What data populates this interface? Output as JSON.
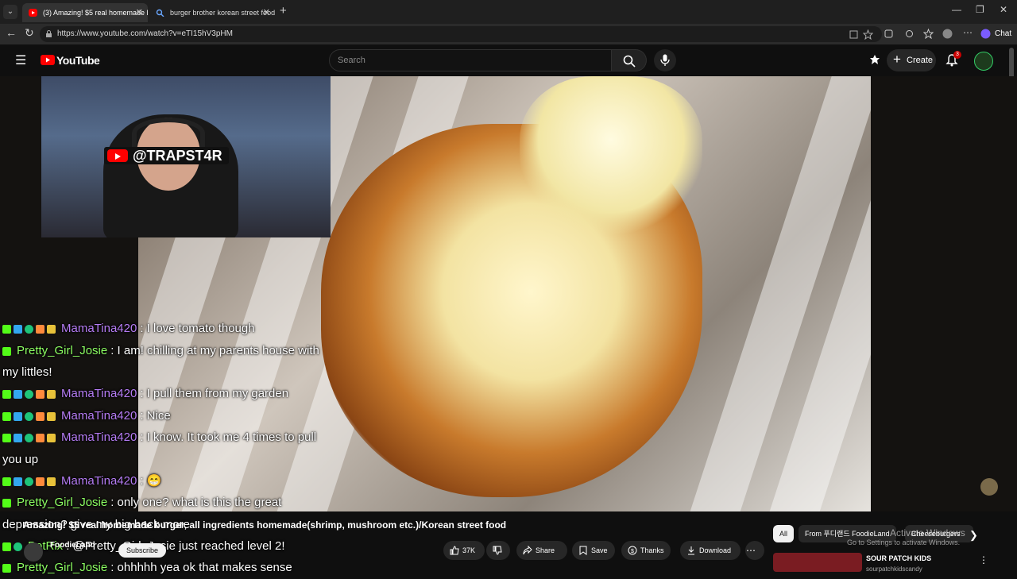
{
  "browser": {
    "tabs": [
      {
        "label": "(3) Amazing! $5 real homemade bu",
        "active": true
      },
      {
        "label": "burger brother korean street food",
        "active": false
      }
    ],
    "url": "https://www.youtube.com/watch?v=eTI15hV3pHM",
    "chat_label": "Chat"
  },
  "youtube": {
    "logo_text": "YouTube",
    "search_placeholder": "Search",
    "create_label": "Create",
    "notification_count": "3"
  },
  "stream": {
    "handle": "@TRAPST4R"
  },
  "chat": [
    {
      "badges": [
        "k",
        "v",
        "c",
        "m",
        "g"
      ],
      "user": "MamaTina420",
      "user_color": "#b57cf4",
      "text": ": I love tomato though"
    },
    {
      "badges": [
        "k"
      ],
      "user": "Pretty_Girl_Josie",
      "user_color": "#8dff63",
      "text": ": I am! chilling at my parents house with my littles!"
    },
    {
      "badges": [
        "k",
        "v",
        "c",
        "m",
        "g"
      ],
      "user": "MamaTina420",
      "user_color": "#b57cf4",
      "text": ": I pull them from my garden"
    },
    {
      "badges": [
        "k",
        "v",
        "c",
        "m",
        "g"
      ],
      "user": "MamaTina420",
      "user_color": "#b57cf4",
      "text": ": Nice"
    },
    {
      "badges": [
        "k",
        "v",
        "c",
        "m",
        "g"
      ],
      "user": "MamaTina420",
      "user_color": "#b57cf4",
      "text": ": I know. It took me 4 times to pull you up"
    },
    {
      "badges": [
        "k",
        "v",
        "c",
        "m",
        "g"
      ],
      "user": "MamaTina420",
      "user_color": "#b57cf4",
      "text": ": 😁"
    },
    {
      "badges": [
        "k"
      ],
      "user": "Pretty_Girl_Josie",
      "user_color": "#8dff63",
      "text": ": only one? what is this the great depression? give my big back more"
    },
    {
      "badges": [
        "k",
        "c"
      ],
      "user": "BotRix",
      "user_color": "#8dff63",
      "text": ": @Pretty_Girl_Josie just reached level 2!"
    },
    {
      "badges": [
        "k"
      ],
      "user": "Pretty_Girl_Josie",
      "user_color": "#8dff63",
      "text": ": ohhhhh yea ok that makes sense"
    }
  ],
  "video": {
    "title": "Amazing! $5 real homemade burger, all ingredients homemade(shrimp, mushroom etc.)/Korean street food",
    "channel": "FoodieLand",
    "subscribe_label": "Subscribe",
    "likes": "37K",
    "share_label": "Share",
    "save_label": "Save",
    "thanks_label": "Thanks",
    "download_label": "Download"
  },
  "chips": [
    "All",
    "From 푸디랜드 FoodieLand",
    "Cheeseburgers"
  ],
  "watermark": {
    "line1": "Activate Windows",
    "line2": "Go to Settings to activate Windows."
  },
  "recommendation": {
    "title": "SOUR PATCH KIDS",
    "channel": "sourpatchkidscandy"
  },
  "colors": {
    "youtube_red": "#ff0000",
    "kick_green": "#53fc18",
    "mama_purple": "#b57cf4",
    "josie_green": "#8dff63"
  }
}
